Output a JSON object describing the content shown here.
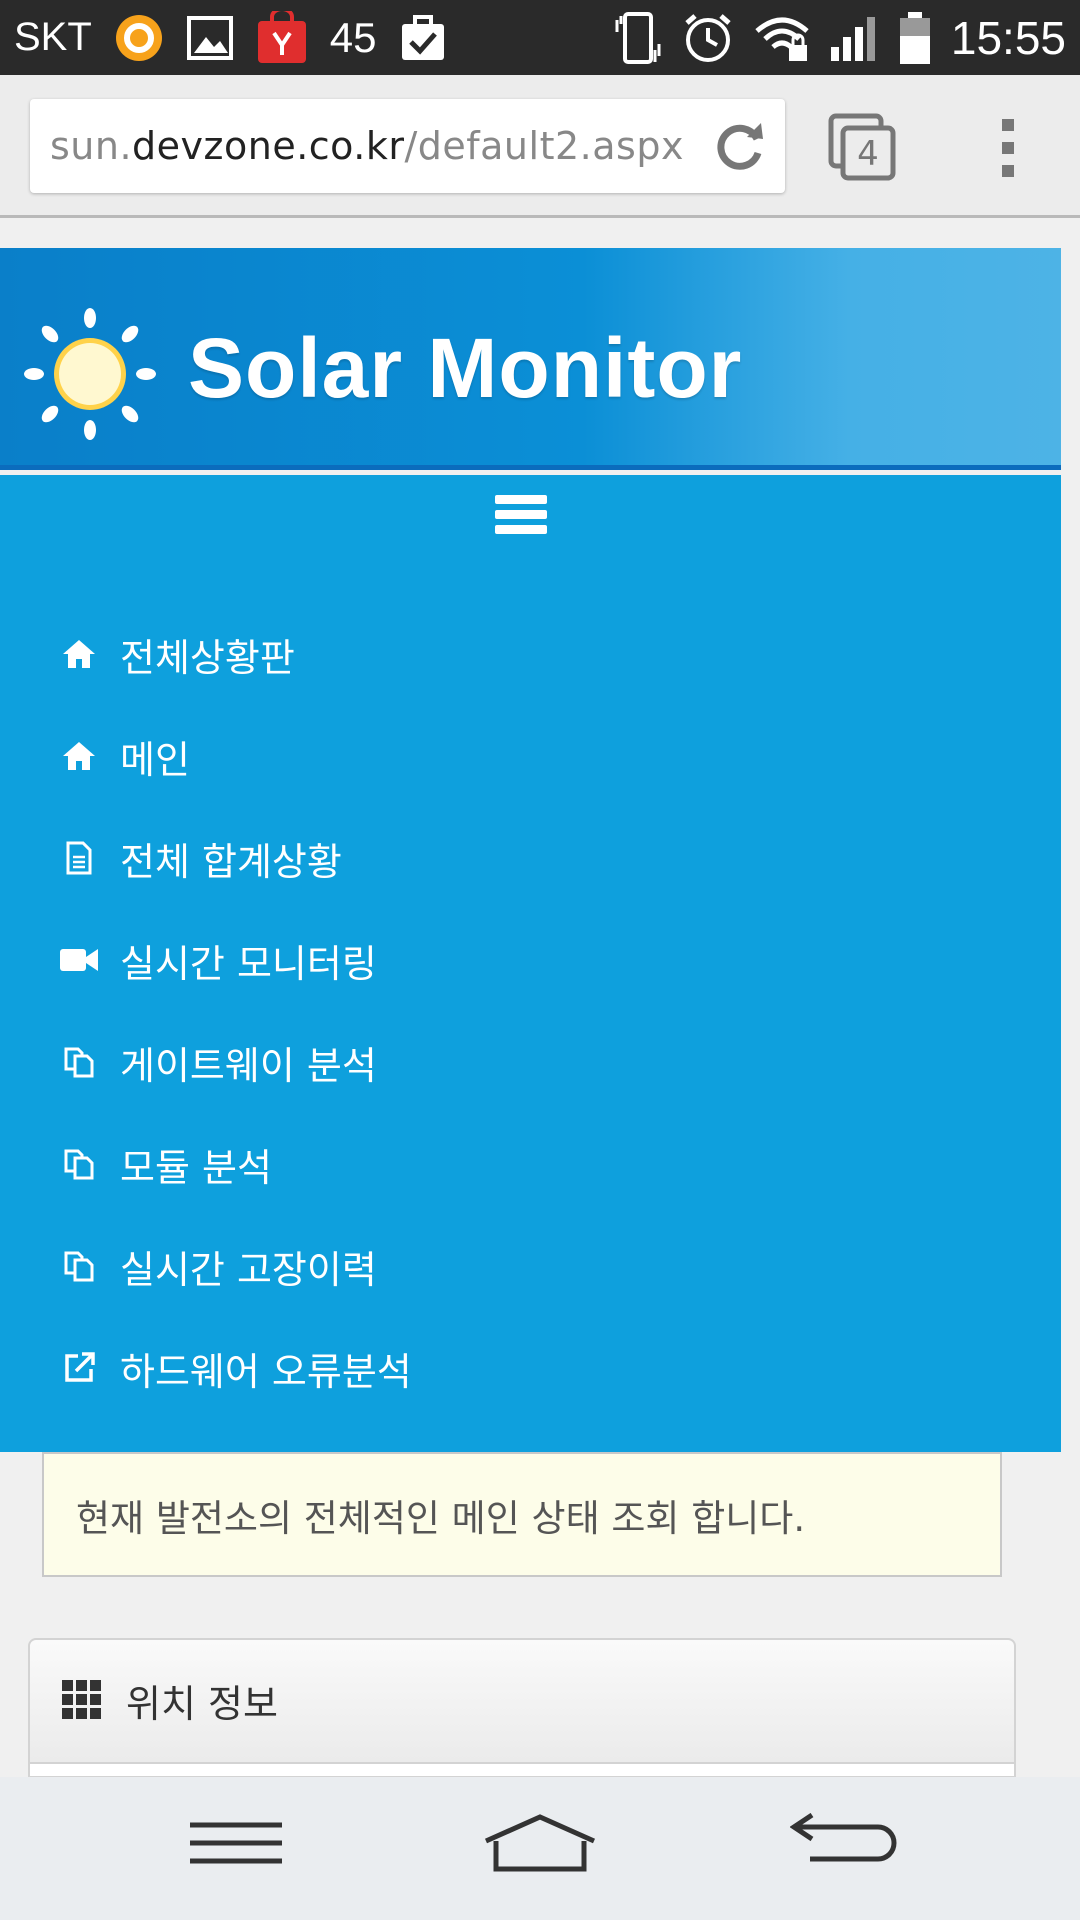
{
  "status_bar": {
    "carrier": "SKT",
    "notification_count": "45",
    "time": "15:55",
    "icons": [
      "olleh-icon",
      "gallery-icon",
      "shopping-bag-icon",
      "task-check-icon",
      "vibrate-icon",
      "alarm-icon",
      "wifi-lock-icon",
      "signal-icon",
      "battery-icon"
    ]
  },
  "browser": {
    "url_prefix": "sun.",
    "url_host": "devzone.co.kr",
    "url_path": "/default2.aspx",
    "tab_count": "4"
  },
  "site": {
    "title": "Solar Monitor"
  },
  "nav": {
    "items": [
      {
        "label": "전체상황판",
        "icon": "home-icon"
      },
      {
        "label": "메인",
        "icon": "home-icon"
      },
      {
        "label": "전체 합계상황",
        "icon": "file-icon"
      },
      {
        "label": "실시간 모니터링",
        "icon": "video-camera-icon"
      },
      {
        "label": "게이트웨이 분석",
        "icon": "copy-icon"
      },
      {
        "label": "모듈 분석",
        "icon": "copy-icon"
      },
      {
        "label": "실시간 고장이력",
        "icon": "copy-icon"
      },
      {
        "label": "하드웨어 오류분석",
        "icon": "external-link-icon"
      }
    ]
  },
  "info": {
    "message": "현재 발전소의 전체적인 메인 상태 조회 합니다."
  },
  "panel": {
    "title": "위치 정보"
  },
  "colors": {
    "nav_bg": "#0ea0dd",
    "header_bg": "#0a7fc9",
    "info_bg": "#fdfde9"
  }
}
